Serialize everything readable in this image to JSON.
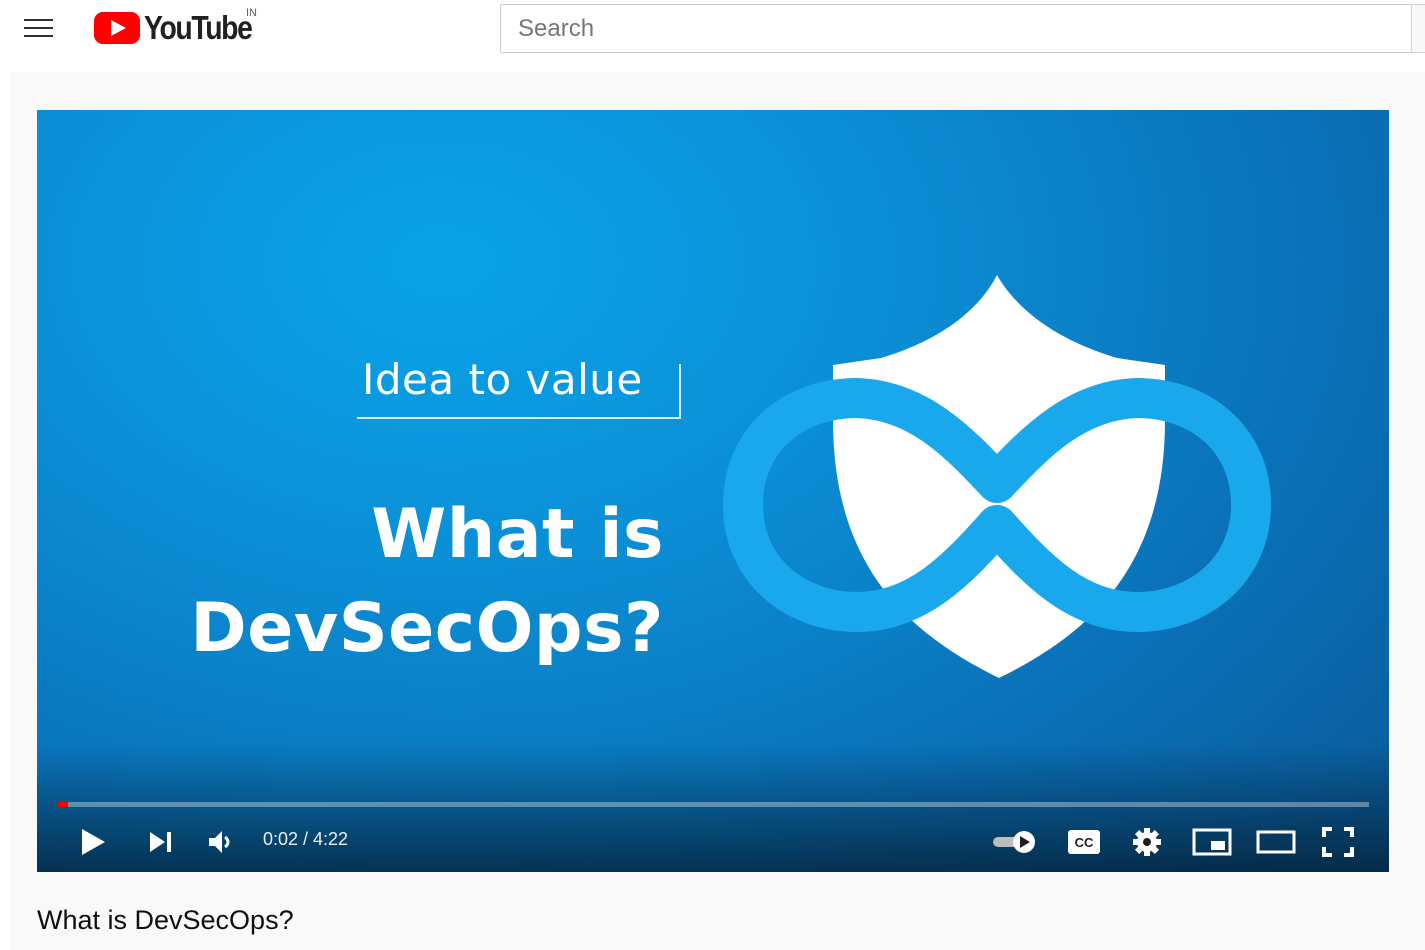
{
  "masthead": {
    "region_code": "IN",
    "logo_text": "YouTube",
    "search_placeholder": "Search",
    "icons": [
      "hamburger-menu-icon",
      "youtube-logo-icon"
    ]
  },
  "player": {
    "frame": {
      "tagline": "Idea to value",
      "headline_line1": "What is",
      "headline_line2": "DevSecOps?"
    },
    "time_current": "0:02",
    "time_total": "4:22",
    "time_display": "0:02 / 4:22",
    "progress": {
      "played_fraction": 0.008,
      "loaded_fraction": 0.008
    },
    "controls": [
      "play-icon",
      "next-icon",
      "volume-icon",
      "autoplay-toggle-icon",
      "captions-icon",
      "settings-icon",
      "miniplayer-icon",
      "theater-mode-icon",
      "fullscreen-icon"
    ],
    "colors": {
      "background": "#0b8fd6",
      "infinity": "#1aa8ec",
      "shield": "#ffffff",
      "progress_played": "#ff0000"
    }
  },
  "video": {
    "title": "What is DevSecOps?"
  }
}
